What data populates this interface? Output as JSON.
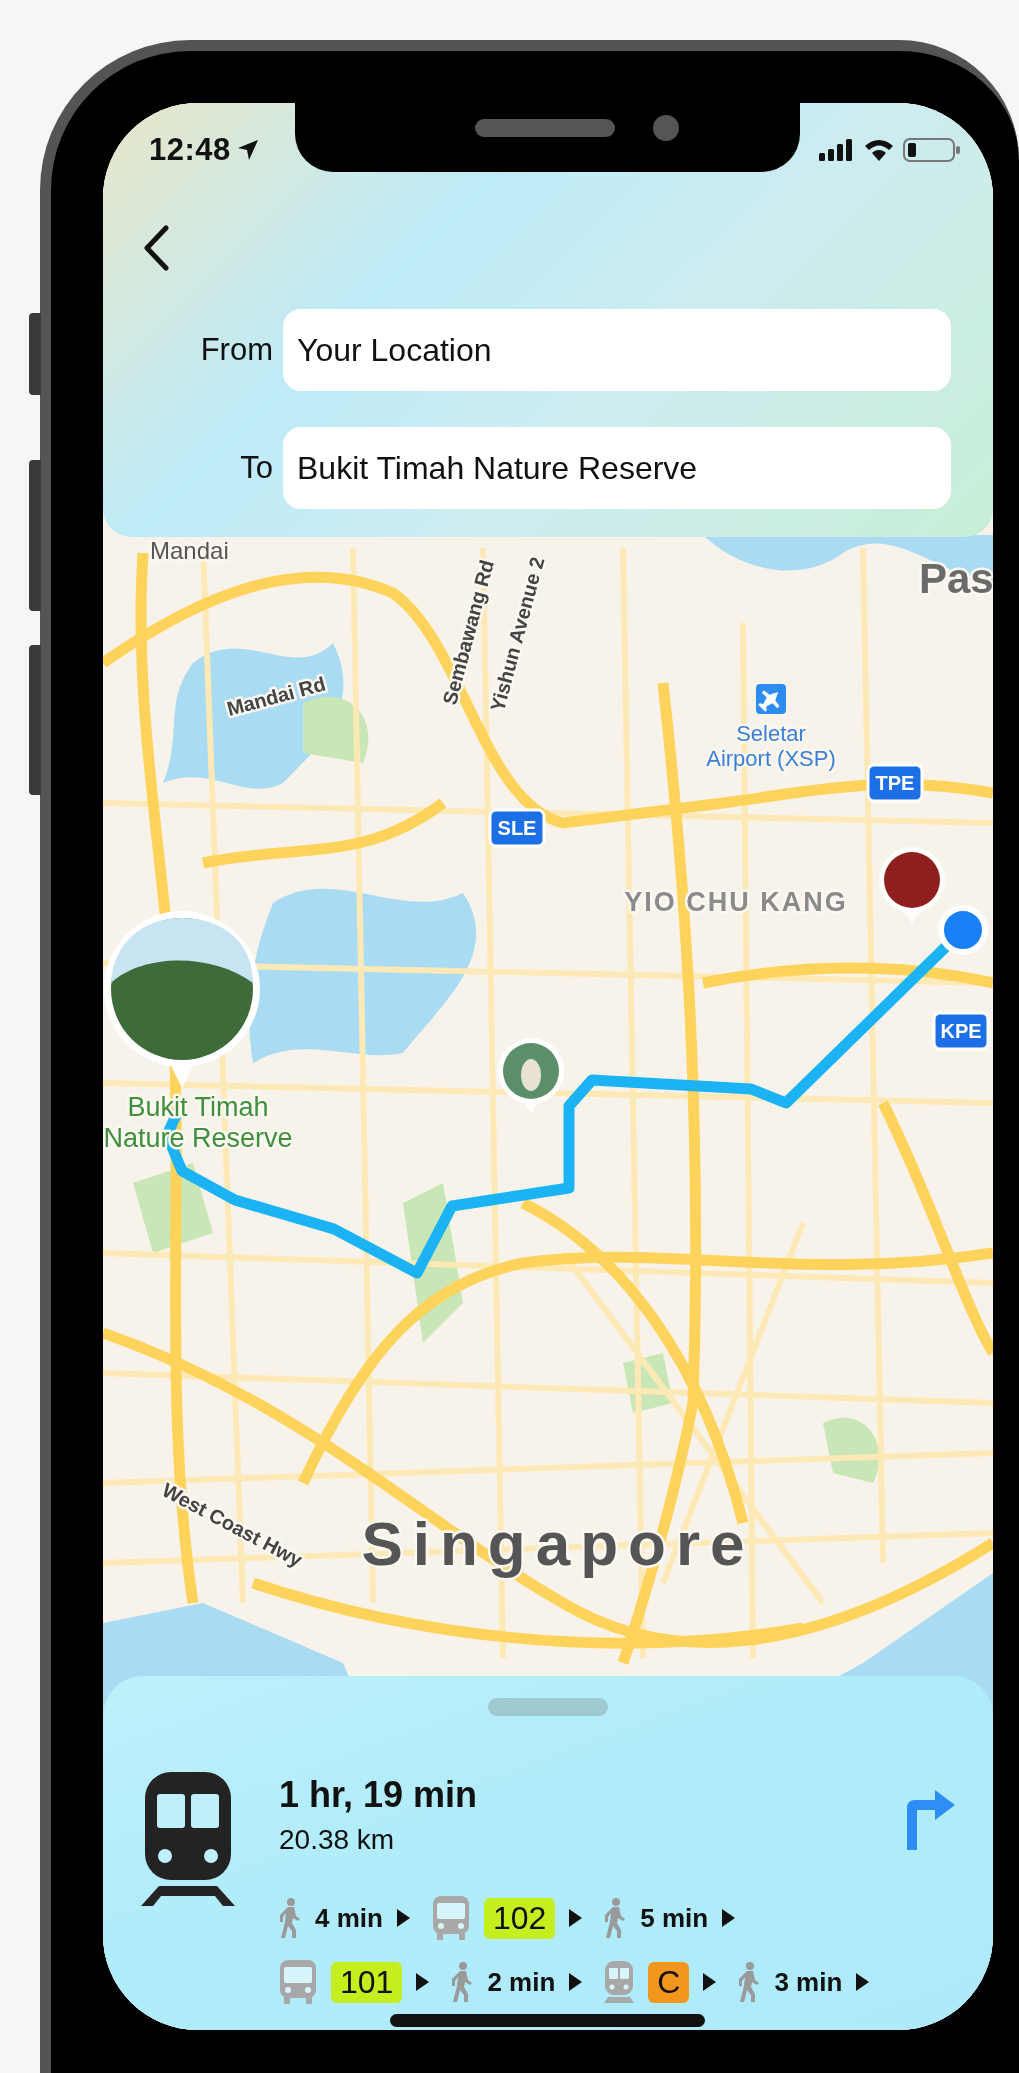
{
  "status_bar": {
    "time": "12:48"
  },
  "header": {
    "fields": [
      {
        "label": "From",
        "value": "Your Location"
      },
      {
        "label": "To",
        "value": "Bukit Timah Nature Reserve"
      }
    ]
  },
  "map": {
    "labels": [
      {
        "kind": "place",
        "lines": [
          "Mandai"
        ]
      },
      {
        "kind": "area",
        "lines": [
          "Pas"
        ]
      },
      {
        "kind": "road",
        "lines": [
          "Mandai Rd"
        ]
      },
      {
        "kind": "road",
        "lines": [
          "Sembawang Rd"
        ]
      },
      {
        "kind": "road",
        "lines": [
          "Yishun Avenue 2"
        ]
      },
      {
        "kind": "airport",
        "lines": [
          "Seletar",
          "Airport (XSP)"
        ]
      },
      {
        "kind": "district",
        "lines": [
          "YIO CHU KANG"
        ]
      },
      {
        "kind": "park",
        "lines": [
          "Bukit Timah",
          "Nature Reserve"
        ]
      },
      {
        "kind": "city",
        "lines": [
          "Singapore"
        ]
      },
      {
        "kind": "road",
        "lines": [
          "West Coast Hwy"
        ]
      }
    ],
    "highway_shields": [
      "SLE",
      "TPE",
      "KPE"
    ]
  },
  "route": {
    "duration": "1 hr, 19 min",
    "distance": "20.38 km",
    "step_rows": [
      [
        {
          "kind": "walk",
          "text": "4 min"
        },
        {
          "kind": "bus",
          "text": "102",
          "color": "#c5ee1f"
        },
        {
          "kind": "walk",
          "text": "5 min"
        }
      ],
      [
        {
          "kind": "bus",
          "text": "101",
          "color": "#c5ee1f"
        },
        {
          "kind": "walk",
          "text": "2 min"
        },
        {
          "kind": "train",
          "text": "C",
          "color": "#f2961e"
        },
        {
          "kind": "walk",
          "text": "3 min"
        }
      ]
    ]
  }
}
